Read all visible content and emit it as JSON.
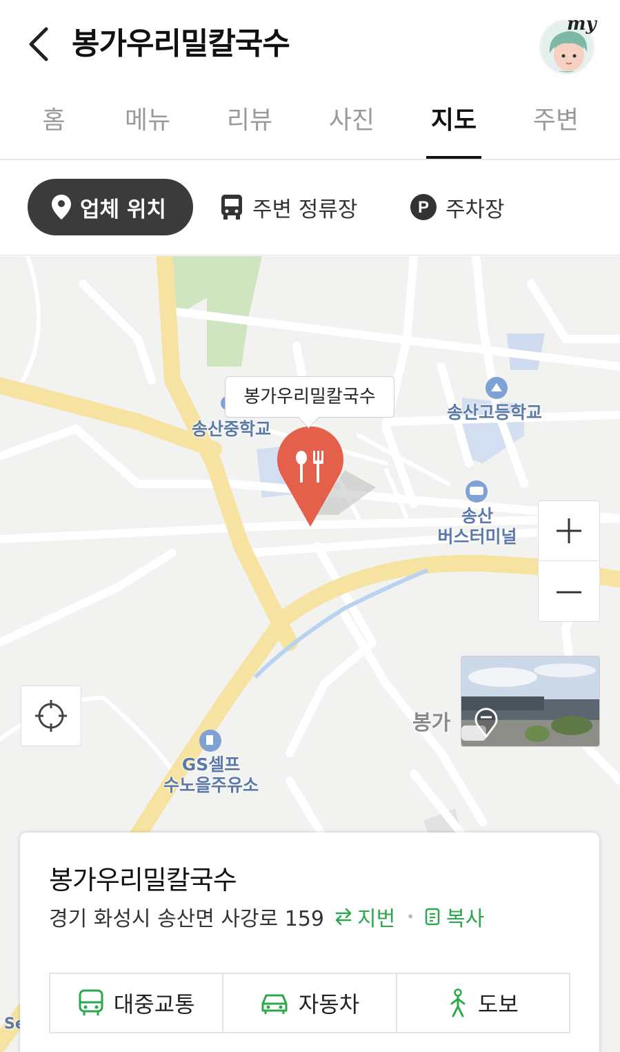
{
  "header": {
    "title": "봉가우리밀칼국수",
    "avatar_text": "my"
  },
  "tabs": [
    {
      "label": "홈",
      "active": false
    },
    {
      "label": "메뉴",
      "active": false
    },
    {
      "label": "리뷰",
      "active": false
    },
    {
      "label": "사진",
      "active": false
    },
    {
      "label": "지도",
      "active": true
    },
    {
      "label": "주변",
      "active": false
    }
  ],
  "chips": {
    "location": "업체 위치",
    "bus_stop": "주변 정류장",
    "parking": "주차장",
    "parking_icon_letter": "P"
  },
  "map": {
    "callout": "봉가우리밀칼국수",
    "labels": {
      "middle_school": "송산중학교",
      "high_school": "송산고등학교",
      "terminal_line1": "송산",
      "terminal_line2": "버스터미널",
      "gas_line1": "GS셀프",
      "gas_line2": "수노을주유소",
      "village": "봉가",
      "corner": "Se"
    },
    "zoom_in": "+",
    "zoom_out": "−"
  },
  "card": {
    "title": "봉가우리밀칼국수",
    "address": "경기 화성시 송산면 사강로 159",
    "lot_label": "지번",
    "copy_label": "복사",
    "transport": [
      "대중교통",
      "자동차",
      "도보"
    ]
  },
  "colors": {
    "accent_green": "#2aa84a",
    "pin_red": "#e5604a",
    "road_yellow": "#f6e3a1",
    "chip_dark": "#3b3b3b"
  }
}
